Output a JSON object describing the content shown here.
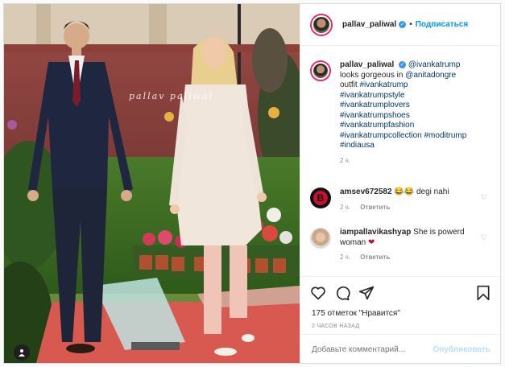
{
  "post": {
    "username": "pallav_paliwal",
    "subscribe_label": "Подписаться",
    "watermark": "pallav paliwal",
    "caption": {
      "username": "pallav_paliwal",
      "mention1": "@ivankatrump",
      "text1": "looks gorgeous in",
      "mention2": "@anitadongre",
      "text2": "outfit",
      "hashtags": [
        "#ivankatrump",
        "#ivankatrumpstyle",
        "#ivankatrumplovers",
        "#ivankatrumpshoes",
        "#ivankatrumpfashion",
        "#ivankatrumpcollection",
        "#moditrump",
        "#indiausa"
      ],
      "time": "2 ч."
    },
    "comments": [
      {
        "username": "amsev672582",
        "text": "😂😂 degi nahi",
        "time": "2 ч.",
        "reply": "Ответить",
        "avatar_letter": "B"
      },
      {
        "username": "iampallavikashyap",
        "text": "She is powerd woman",
        "emoji": "❤",
        "time": "2 ч.",
        "reply": "Ответить"
      }
    ],
    "likes": "175 отметок \"Нравится\"",
    "timestamp": "2 ЧАСОВ НАЗАД",
    "comment_placeholder": "Добавьте комментарий...",
    "publish_label": "Опубликовать"
  }
}
